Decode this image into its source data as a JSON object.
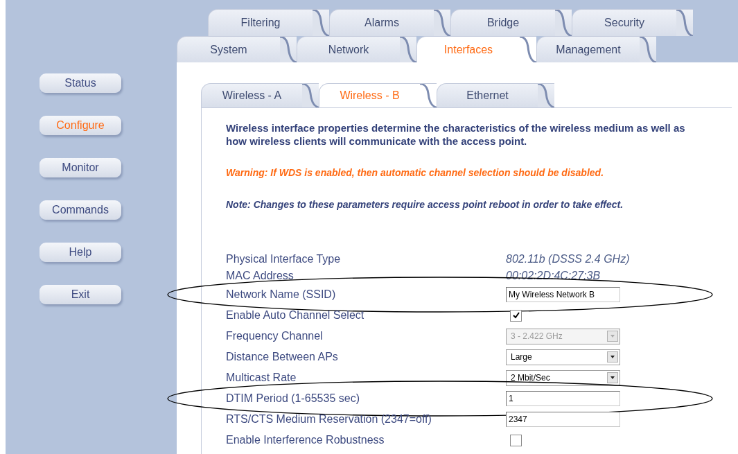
{
  "tabs_row_1": [
    {
      "label": "Filtering",
      "selected": false
    },
    {
      "label": "Alarms",
      "selected": false
    },
    {
      "label": "Bridge",
      "selected": false
    },
    {
      "label": "Security",
      "selected": false
    }
  ],
  "tabs_row_2": [
    {
      "label": "System",
      "selected": false
    },
    {
      "label": "Network",
      "selected": false
    },
    {
      "label": "Interfaces",
      "selected": true
    },
    {
      "label": "Management",
      "selected": false
    }
  ],
  "sidebar": {
    "items": [
      {
        "label": "Status",
        "selected": false
      },
      {
        "label": "Configure",
        "selected": true
      },
      {
        "label": "Monitor",
        "selected": false
      },
      {
        "label": "Commands",
        "selected": false
      },
      {
        "label": "Help",
        "selected": false
      },
      {
        "label": "Exit",
        "selected": false
      }
    ]
  },
  "sub_tabs": [
    {
      "label": "Wireless - A",
      "selected": false
    },
    {
      "label": "Wireless - B",
      "selected": true
    },
    {
      "label": "Ethernet",
      "selected": false
    }
  ],
  "description": "Wireless interface properties determine the characteristics of the wireless medium as well as how wireless clients will communicate with the access point.",
  "warning": "Warning: If WDS is enabled, then automatic channel selection should be disabled.",
  "note": "Note: Changes to these parameters require access point reboot in order to take effect.",
  "fields": [
    {
      "label": "Physical Interface Type",
      "kind": "text",
      "value": "802.11b (DSSS 2.4 GHz)",
      "highlighted": false
    },
    {
      "label": "MAC Address",
      "kind": "text",
      "value": "00:02:2D:4C:27:3B",
      "highlighted": false
    },
    {
      "label": "Network Name (SSID)",
      "kind": "input",
      "value": "My Wireless Network B",
      "highlighted": true
    },
    {
      "label": "Enable Auto Channel Select",
      "kind": "checkbox",
      "checked": true,
      "highlighted": false
    },
    {
      "label": "Frequency Channel",
      "kind": "select",
      "value": "3 - 2.422 GHz",
      "disabled": true,
      "highlighted": false
    },
    {
      "label": "Distance Between APs",
      "kind": "select",
      "value": "Large",
      "disabled": false,
      "highlighted": false
    },
    {
      "label": "Multicast Rate",
      "kind": "select",
      "value": "2 Mbit/Sec",
      "disabled": false,
      "highlighted": false
    },
    {
      "label": "DTIM Period (1-65535 sec)",
      "kind": "input",
      "value": "1",
      "highlighted": true
    },
    {
      "label": "RTS/CTS Medium Reservation (2347=off)",
      "kind": "input",
      "value": "2347",
      "highlighted": false
    },
    {
      "label": "Enable Interference Robustness",
      "kind": "checkbox",
      "checked": false,
      "highlighted": false
    }
  ]
}
